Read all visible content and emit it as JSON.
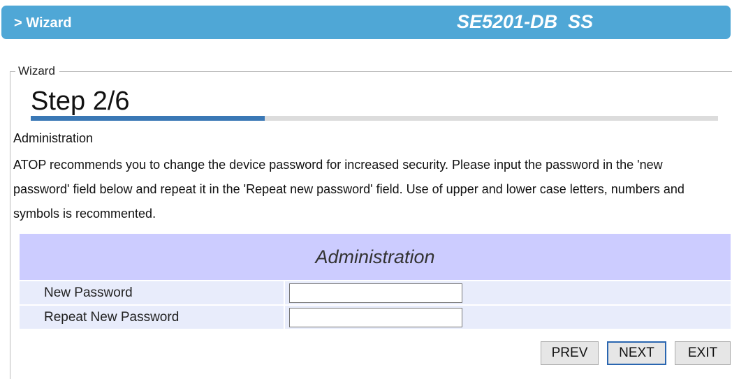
{
  "header": {
    "breadcrumb": "> Wizard",
    "model": "SE5201-DB  SS",
    "bar_color": "#4fa7d6"
  },
  "wizard": {
    "legend": "Wizard",
    "step_label": "Step 2/6",
    "step_current": 2,
    "step_total": 6,
    "progress_fraction": 0.34,
    "progress_color": "#3a78b5",
    "section": "Administration",
    "description": "ATOP recommends you to change the device password for increased security. Please input the password in the 'new password' field below and repeat it in the 'Repeat new password' field. Use of upper and lower case letters, numbers and symbols is recommented."
  },
  "admin_table": {
    "title": "Administration",
    "header_color": "#ccccff",
    "rows": [
      {
        "label": "New Password",
        "value": ""
      },
      {
        "label": "Repeat New Password",
        "value": ""
      }
    ]
  },
  "buttons": {
    "prev": "PREV",
    "next": "NEXT",
    "exit": "EXIT"
  }
}
